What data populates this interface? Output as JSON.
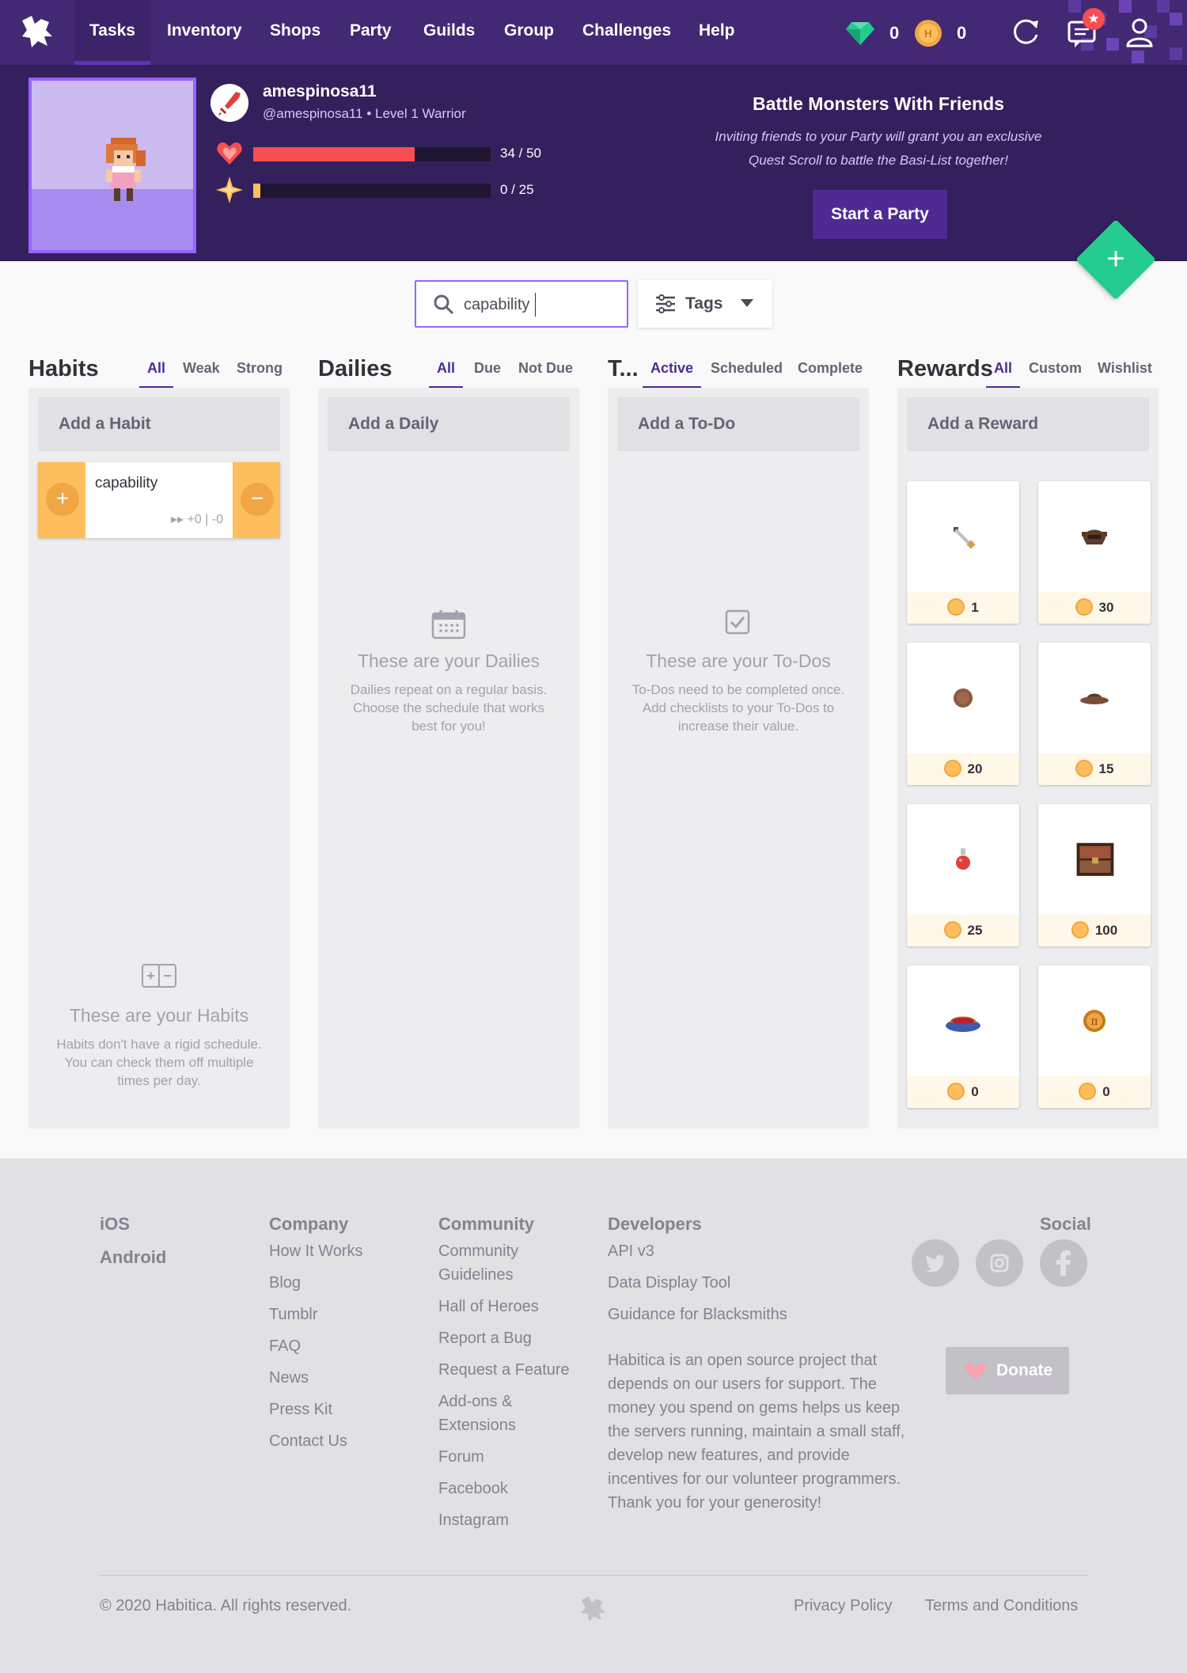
{
  "nav": {
    "items": [
      "Tasks",
      "Inventory",
      "Shops",
      "Party",
      "Guilds",
      "Group",
      "Challenges",
      "Help"
    ],
    "gems": "0",
    "gold": "0",
    "notification_count": "★"
  },
  "user": {
    "name": "amespinosa11",
    "handle": "@amespinosa11",
    "level_text": "Level 1 Warrior",
    "hp_text": "34 / 50",
    "hp_fraction": 0.68,
    "xp_text": "0 / 25",
    "xp_fraction": 0,
    "hp_color": "#f74e52",
    "xp_color": "#ffbe5d"
  },
  "party": {
    "title": "Battle Monsters With Friends",
    "text_line1": "Inviting friends to your Party will grant you an exclusive",
    "text_line2": "Quest Scroll to battle the Basi-List together!",
    "button": "Start a Party"
  },
  "search": {
    "value": "capability"
  },
  "tags_label": "Tags",
  "habits": {
    "title": "Habits",
    "tabs": [
      "All",
      "Weak",
      "Strong"
    ],
    "add_label": "Add a Habit",
    "task_text": "capability",
    "task_count": "+0 | -0",
    "empty_title": "These are your Habits",
    "empty_text": "Habits don't have a rigid schedule. You can check them off multiple times per day."
  },
  "dailies": {
    "title": "Dailies",
    "tabs": [
      "All",
      "Due",
      "Not Due"
    ],
    "add_label": "Add a Daily",
    "empty_title": "These are your Dailies",
    "empty_text": "Dailies repeat on a regular basis. Choose the schedule that works best for you!"
  },
  "todos": {
    "title": "T...",
    "tabs": [
      "Active",
      "Scheduled",
      "Complete"
    ],
    "add_label": "Add a To-Do",
    "empty_title": "These are your To-Dos",
    "empty_text": "To-Dos need to be completed once. Add checklists to your To-Dos to increase their value."
  },
  "rewards": {
    "title": "Rewards",
    "tabs": [
      "All",
      "Custom",
      "Wishlist"
    ],
    "add_label": "Add a Reward",
    "items": [
      {
        "price": "1",
        "icon": "sword-icon"
      },
      {
        "price": "30",
        "icon": "helmet-icon"
      },
      {
        "price": "20",
        "icon": "shield-icon"
      },
      {
        "price": "15",
        "icon": "hat-icon"
      },
      {
        "price": "25",
        "icon": "health-potion-icon"
      },
      {
        "price": "100",
        "icon": "armoire-chest-icon"
      },
      {
        "price": "0",
        "icon": "pie-icon"
      },
      {
        "price": "0",
        "icon": "medal-icon"
      }
    ]
  },
  "footer": {
    "apps": [
      "iOS",
      "Android"
    ],
    "company_title": "Company",
    "company_links": [
      "How It Works",
      "Blog",
      "Tumblr",
      "FAQ",
      "News",
      "Press Kit",
      "Contact Us"
    ],
    "community_title": "Community",
    "community_links": [
      "Community Guidelines",
      "Hall of Heroes",
      "Report a Bug",
      "Request a Feature",
      "Add-ons & Extensions",
      "Forum",
      "Facebook",
      "Instagram"
    ],
    "developers_title": "Developers",
    "developers_links": [
      "API v3",
      "Data Display Tool",
      "Guidance for Blacksmiths"
    ],
    "developers_text": "Habitica is an open source project that depends on our users for support. The money you spend on gems helps us keep the servers running, maintain a small staff, develop new features, and provide incentives for our volunteer programmers. Thank you for your generosity!",
    "social_title": "Social",
    "donate_label": "Donate",
    "copyright": "© 2020 Habitica. All rights reserved.",
    "privacy": "Privacy Policy",
    "terms": "Terms and Conditions"
  }
}
